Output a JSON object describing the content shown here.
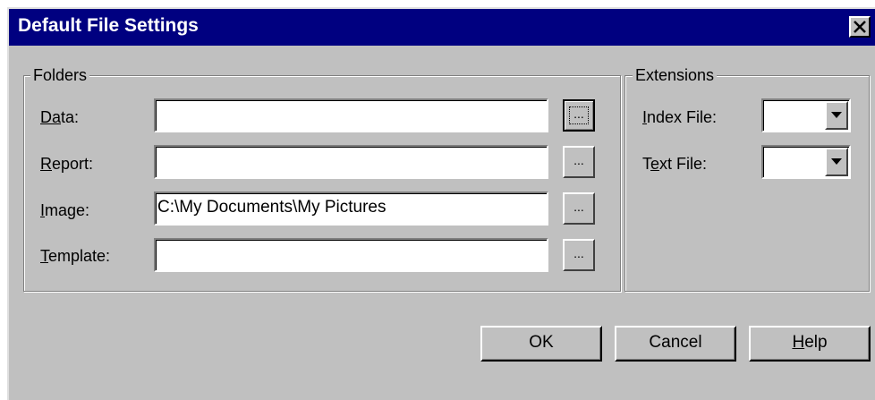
{
  "window": {
    "title": "Default File Settings",
    "close_icon": "close-x-icon"
  },
  "folders": {
    "legend": "Folders",
    "rows": [
      {
        "label_accel": "D",
        "label_mid": "a",
        "label_accel2": "t",
        "label_rest": "a:",
        "value": "",
        "browse": "..."
      },
      {
        "label_accel": "R",
        "label_rest": "eport:",
        "value": "",
        "browse": "..."
      },
      {
        "label_accel": "I",
        "label_rest": "mage:",
        "value": "C:\\My Documents\\My Pictures",
        "browse": "..."
      },
      {
        "label_accel": "T",
        "label_rest": "emplate:",
        "value": "",
        "browse": "..."
      }
    ]
  },
  "extensions": {
    "legend": "Extensions",
    "index": {
      "label_accel": "I",
      "label_rest": "ndex File:",
      "value": ""
    },
    "text": {
      "label_pre": "T",
      "label_accel": "e",
      "label_rest": "xt File:",
      "value": ""
    },
    "dropdown_icon": "chevron-down-icon"
  },
  "buttons": {
    "ok": "OK",
    "cancel": "Cancel",
    "help_accel": "H",
    "help_rest": "elp"
  },
  "colors": {
    "face": "#c0c0c0",
    "title_bar": "#000080",
    "title_text": "#ffffff",
    "field": "#ffffff"
  }
}
